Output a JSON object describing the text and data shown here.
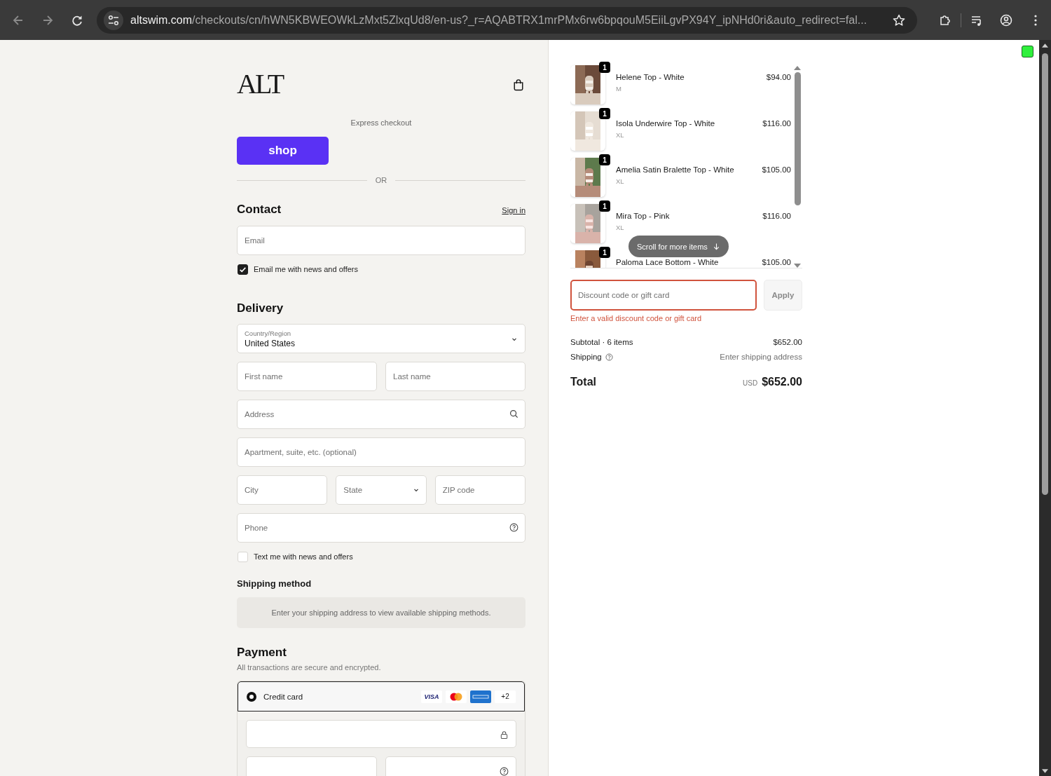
{
  "browser": {
    "host": "altswim.com",
    "path": "/checkouts/cn/hWN5KBWEOWkLzMxt5ZlxqUd8/en-us?_r=AQABTRX1mrPMx6rw6bpqouM5EiiLgvPX94Y_ipNHd0ri&auto_redirect=fal..."
  },
  "logo": "ALT",
  "express": {
    "label": "Express checkout",
    "button": "shop",
    "divider": "OR"
  },
  "contact": {
    "heading": "Contact",
    "sign_in": "Sign in",
    "email_placeholder": "Email",
    "newsletter": {
      "label": "Email me with news and offers",
      "checked": true
    }
  },
  "delivery": {
    "heading": "Delivery",
    "country": {
      "label": "Country/Region",
      "value": "United States"
    },
    "rows": [
      [
        {
          "kind": "text",
          "placeholder": "First name"
        },
        {
          "kind": "text",
          "placeholder": "Last name"
        }
      ],
      [
        {
          "kind": "search",
          "placeholder": "Address"
        }
      ],
      [
        {
          "kind": "text",
          "placeholder": "Apartment, suite, etc. (optional)"
        }
      ],
      [
        {
          "kind": "text",
          "placeholder": "City"
        },
        {
          "kind": "select",
          "placeholder": "State"
        },
        {
          "kind": "text",
          "placeholder": "ZIP code"
        }
      ],
      [
        {
          "kind": "help",
          "placeholder": "Phone"
        }
      ]
    ],
    "sms": {
      "label": "Text me with news and offers",
      "checked": false
    }
  },
  "shipping_method": {
    "heading": "Shipping method",
    "note": "Enter your shipping address to view available shipping methods."
  },
  "payment": {
    "heading": "Payment",
    "note": "All transactions are secure and encrypted.",
    "methods": [
      {
        "label": "Credit card",
        "selected": true,
        "cards": [
          {
            "kind": "visa",
            "label": "VISA"
          },
          {
            "kind": "mastercard"
          },
          {
            "kind": "amex"
          },
          {
            "kind": "more",
            "label": "+2"
          }
        ]
      }
    ],
    "card_rows": [
      [
        {
          "kind": "lock"
        }
      ],
      [
        {
          "kind": "text"
        },
        {
          "kind": "help"
        }
      ]
    ]
  },
  "cart": {
    "items": [
      {
        "name": "Helene Top - White",
        "variant": "M",
        "price": "$94.00",
        "quantity": "1"
      },
      {
        "name": "Isola Underwire Top - White",
        "variant": "XL",
        "price": "$116.00",
        "quantity": "1"
      },
      {
        "name": "Amelia Satin Bralette Top - White",
        "variant": "XL",
        "price": "$105.00",
        "quantity": "1"
      },
      {
        "name": "Mira Top - Pink",
        "variant": "XL",
        "price": "$116.00",
        "quantity": "1"
      },
      {
        "name": "Paloma Lace Bottom - White",
        "price": "$105.00",
        "quantity": "1"
      }
    ],
    "scroll_hint": "Scroll for more items"
  },
  "discount": {
    "placeholder": "Discount code or gift card",
    "error": "Enter a valid discount code or gift card",
    "button": "Apply",
    "disabled": true
  },
  "summary": {
    "subtotal_label": "Subtotal · 6 items",
    "subtotal": "$652.00",
    "shipping_label": "Shipping",
    "shipping": "Enter shipping address",
    "total_label": "Total",
    "currency": "USD",
    "total": "$652.00"
  }
}
